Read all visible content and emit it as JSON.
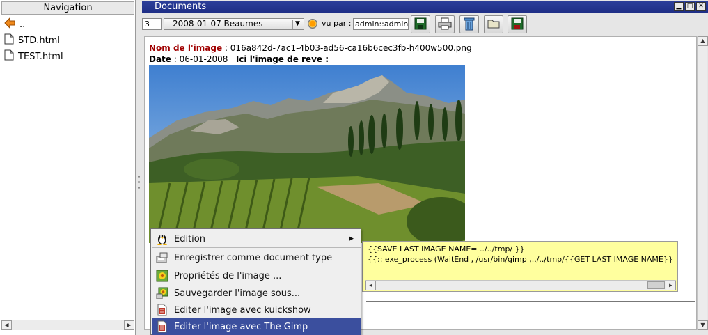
{
  "navigation": {
    "title": "Navigation",
    "items": [
      {
        "label": "..",
        "icon": "back-arrow-icon"
      },
      {
        "label": "STD.html",
        "icon": "file-icon"
      },
      {
        "label": "TEST.html",
        "icon": "file-icon"
      }
    ]
  },
  "documents": {
    "title": "Documents",
    "toolbar": {
      "page_number": "3",
      "document_selected": "2008-01-07 Beaumes",
      "seen_by_label": "vu par :",
      "seen_by_value": "admin::admin",
      "buttons": [
        "save-icon",
        "print-icon",
        "trash-icon",
        "folder-icon",
        "save-as-icon"
      ]
    },
    "content": {
      "image_name_label": "Nom de l'image",
      "image_name_value": ": 016a842d-7ac1-4b03-ad56-ca16b6cec3fb-h400w500.png",
      "date_label": "Date",
      "date_value": ": 06-01-2008",
      "image_caption": "Ici l'image de reve :"
    },
    "command_box": {
      "line1": "{{SAVE LAST IMAGE NAME= ../../tmp/ }}",
      "line2": "{{:: exe_process (WaitEnd , /usr/bin/gimp ,../../tmp/{{GET LAST IMAGE NAME}}"
    }
  },
  "context_menu": {
    "items": [
      {
        "label": "Edition",
        "icon": "tux-icon",
        "submenu": true
      },
      {
        "label": "Enregistrer comme document type",
        "icon": "disk-save-icon"
      },
      {
        "label": "Propriétés de l'image ...",
        "icon": "flower-icon"
      },
      {
        "label": "Sauvegarder l'image sous...",
        "icon": "flower-save-icon"
      },
      {
        "label": "Editer l'image avec kuickshow",
        "icon": "document-red-icon"
      },
      {
        "label": "Editer l'image avec The Gimp",
        "icon": "document-red-icon",
        "selected": true
      }
    ],
    "colors": {
      "selected_bg": "#3b4f9e",
      "menu_bg": "#efefef"
    }
  },
  "colors": {
    "title_bar": "#2c3f9b",
    "command_box_bg": "#ffff9e",
    "label_red": "#a00000"
  }
}
